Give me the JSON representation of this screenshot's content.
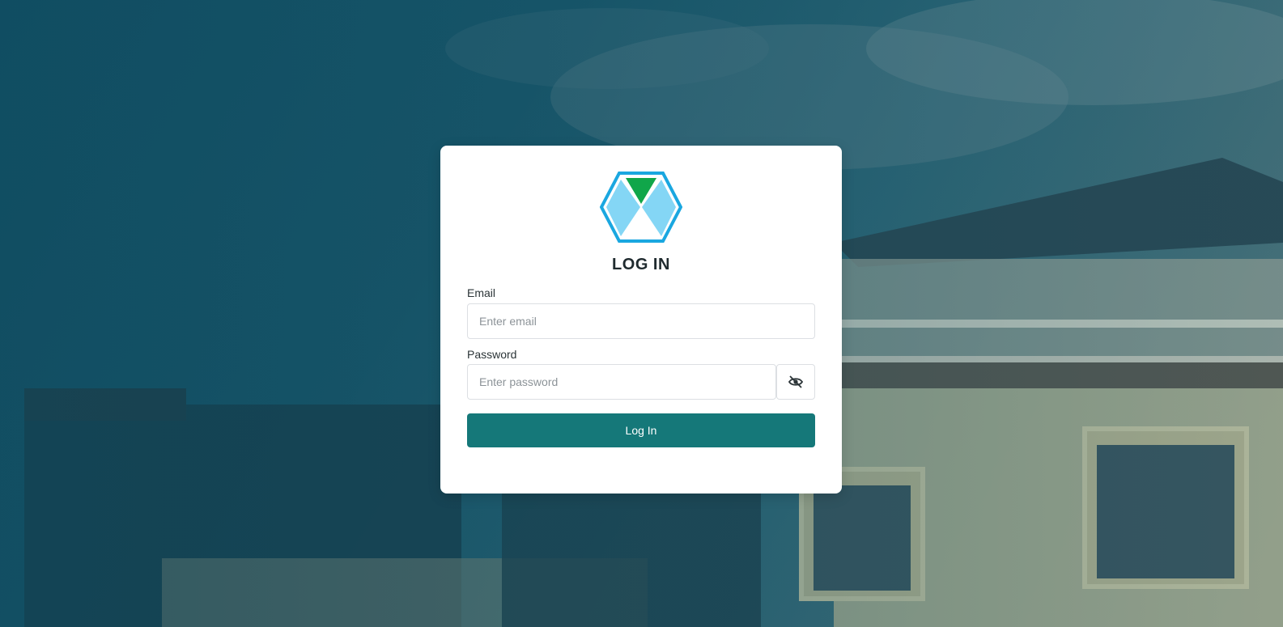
{
  "colors": {
    "accent": "#157879",
    "logo_outline": "#1aa7e0",
    "logo_fill": "#84d6f5",
    "logo_triangle": "#10a64a"
  },
  "logo": {
    "icon": "hexagon-logo-icon"
  },
  "form": {
    "title": "LOG IN",
    "email_label": "Email",
    "email_placeholder": "Enter email",
    "email_value": "",
    "password_label": "Password",
    "password_placeholder": "Enter password",
    "password_value": "",
    "toggle_icon": "eye-slash-icon",
    "submit_label": "Log In"
  }
}
